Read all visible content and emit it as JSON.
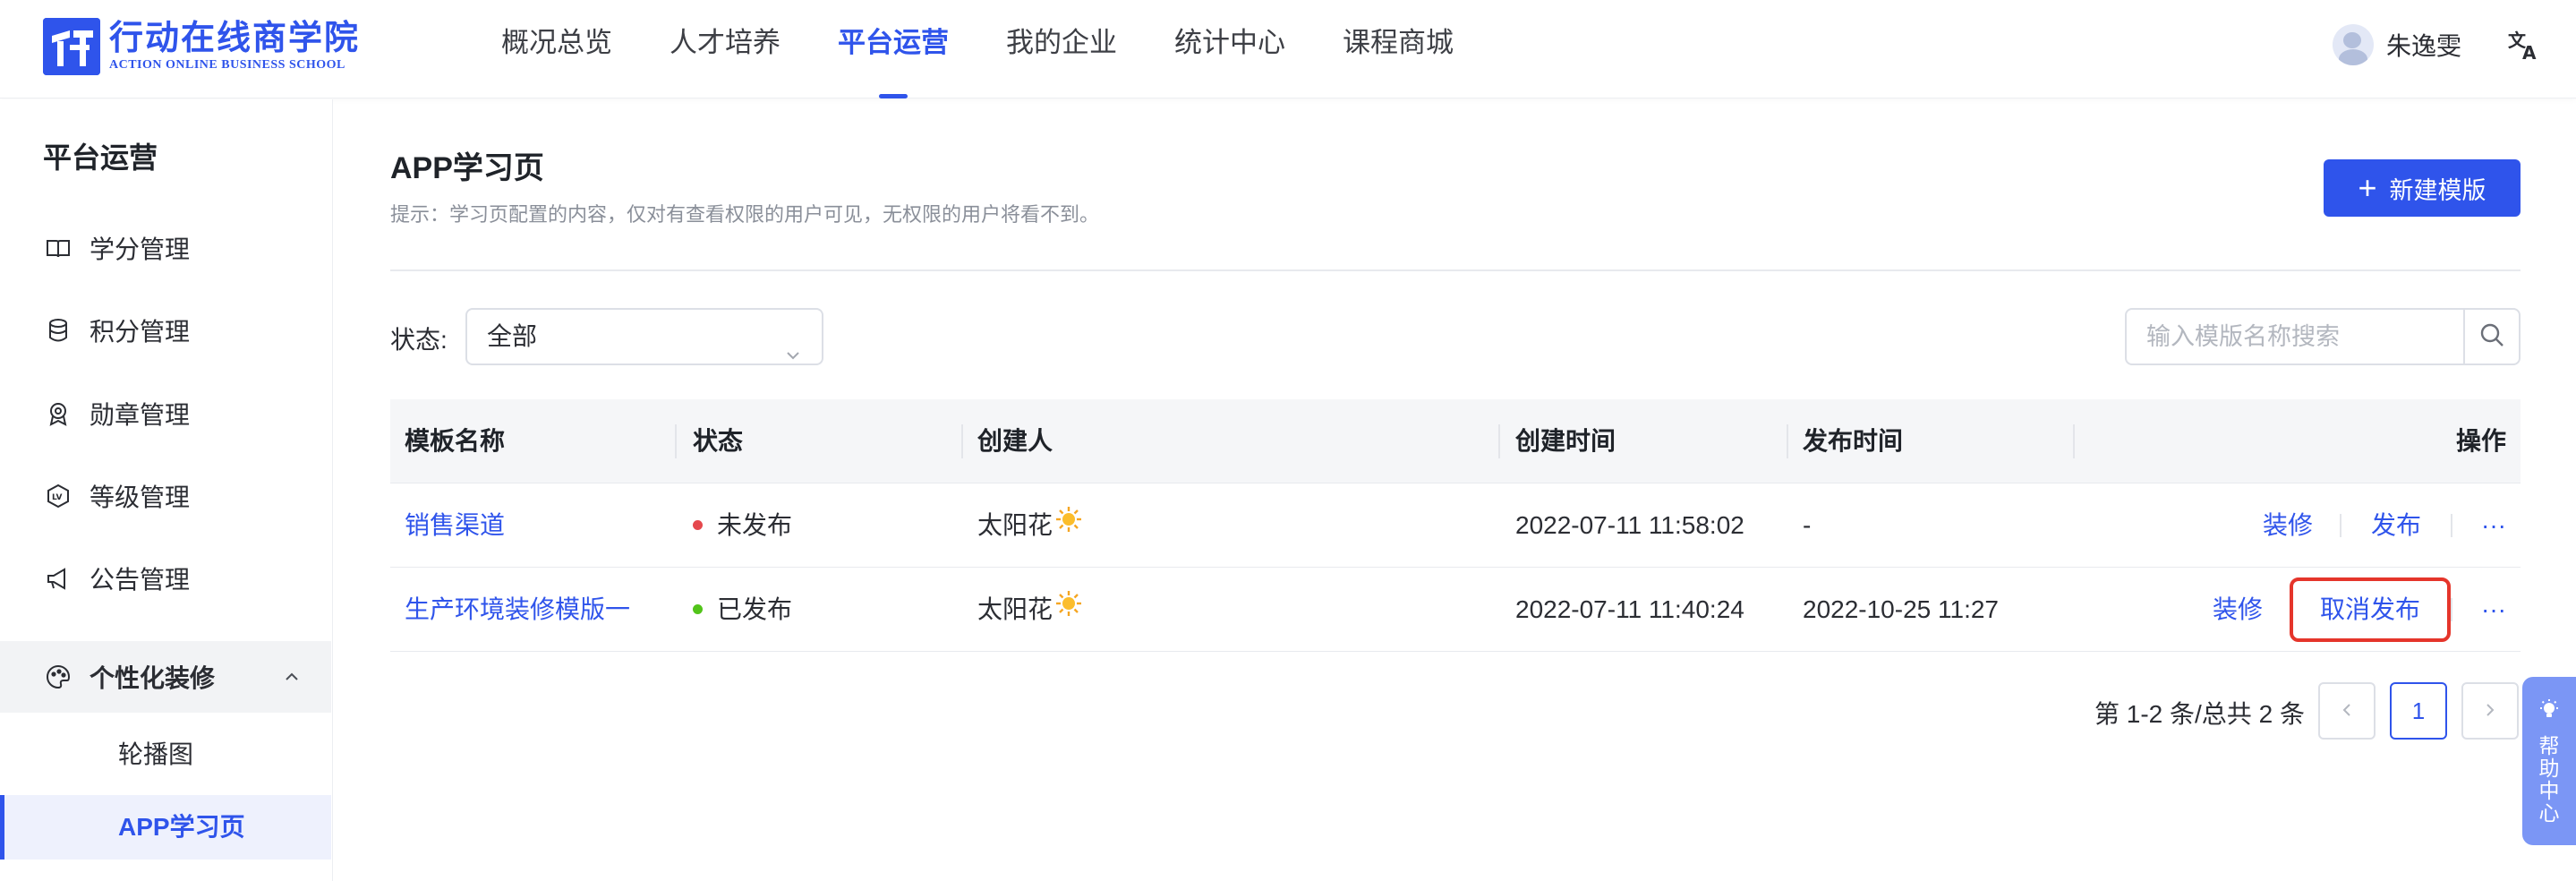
{
  "brand": {
    "name_cn": "行动在线商学院",
    "name_en": "ACTION ONLINE BUSINESS SCHOOL",
    "color": "#2f54eb"
  },
  "nav": {
    "items": [
      {
        "label": "概况总览"
      },
      {
        "label": "人才培养"
      },
      {
        "label": "平台运营",
        "active": true
      },
      {
        "label": "我的企业"
      },
      {
        "label": "统计中心"
      },
      {
        "label": "课程商城"
      }
    ]
  },
  "user": {
    "name": "朱逸雯"
  },
  "sidebar": {
    "title": "平台运营",
    "items": [
      {
        "label": "学分管理",
        "icon": "book-icon"
      },
      {
        "label": "积分管理",
        "icon": "database-icon"
      },
      {
        "label": "勋章管理",
        "icon": "medal-icon"
      },
      {
        "label": "等级管理",
        "icon": "level-icon"
      },
      {
        "label": "公告管理",
        "icon": "megaphone-icon"
      }
    ],
    "group": {
      "label": "个性化装修",
      "icon": "palette-icon",
      "expanded": true,
      "children": [
        {
          "label": "轮播图"
        },
        {
          "label": "APP学习页",
          "active": true
        }
      ]
    }
  },
  "page": {
    "title": "APP学习页",
    "tip": "提示：学习页配置的内容，仅对有查看权限的用户可见，无权限的用户将看不到。",
    "new_button": "新建模版"
  },
  "filter": {
    "status_label": "状态:",
    "status_value": "全部",
    "search_placeholder": "输入模版名称搜索"
  },
  "table": {
    "columns": [
      "模板名称",
      "状态",
      "创建人",
      "创建时间",
      "发布时间",
      "操作"
    ],
    "rows": [
      {
        "name": "销售渠道",
        "status": "未发布",
        "status_color": "#e5484d",
        "creator": "太阳花",
        "created": "2022-07-11 11:58:02",
        "published": "-",
        "actions": [
          "装修",
          "发布",
          "···"
        ]
      },
      {
        "name": "生产环境装修模版一",
        "status": "已发布",
        "status_color": "#52c41a",
        "creator": "太阳花",
        "created": "2022-07-11 11:40:24",
        "published": "2022-10-25 11:27",
        "actions": [
          "装修",
          "取消发布",
          "···"
        ]
      }
    ]
  },
  "pagination": {
    "summary": "第 1-2 条/总共 2 条",
    "current_page": "1",
    "prev": "<",
    "next": ">"
  },
  "help": {
    "label": "帮助中心"
  }
}
